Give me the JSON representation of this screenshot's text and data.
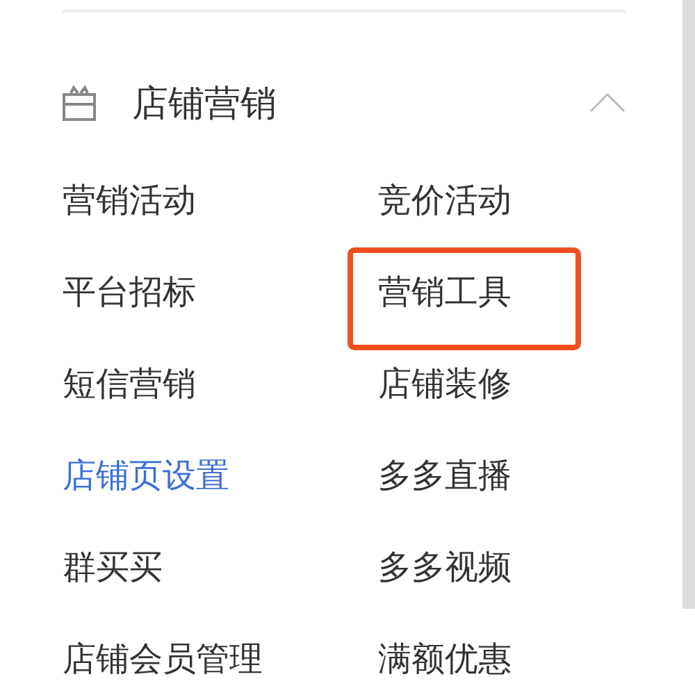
{
  "section": {
    "title": "店铺营销",
    "expanded": true,
    "items": [
      {
        "label": "营销活动",
        "selected": false,
        "highlighted": false
      },
      {
        "label": "竞价活动",
        "selected": false,
        "highlighted": false
      },
      {
        "label": "平台招标",
        "selected": false,
        "highlighted": false
      },
      {
        "label": "营销工具",
        "selected": false,
        "highlighted": true
      },
      {
        "label": "短信营销",
        "selected": false,
        "highlighted": false
      },
      {
        "label": "店铺装修",
        "selected": false,
        "highlighted": false
      },
      {
        "label": "店铺页设置",
        "selected": true,
        "highlighted": false
      },
      {
        "label": "多多直播",
        "selected": false,
        "highlighted": false
      },
      {
        "label": "群买买",
        "selected": false,
        "highlighted": false
      },
      {
        "label": "多多视频",
        "selected": false,
        "highlighted": false
      },
      {
        "label": "店铺会员管理",
        "selected": false,
        "highlighted": false
      },
      {
        "label": "满额优惠",
        "selected": false,
        "highlighted": false
      }
    ]
  }
}
